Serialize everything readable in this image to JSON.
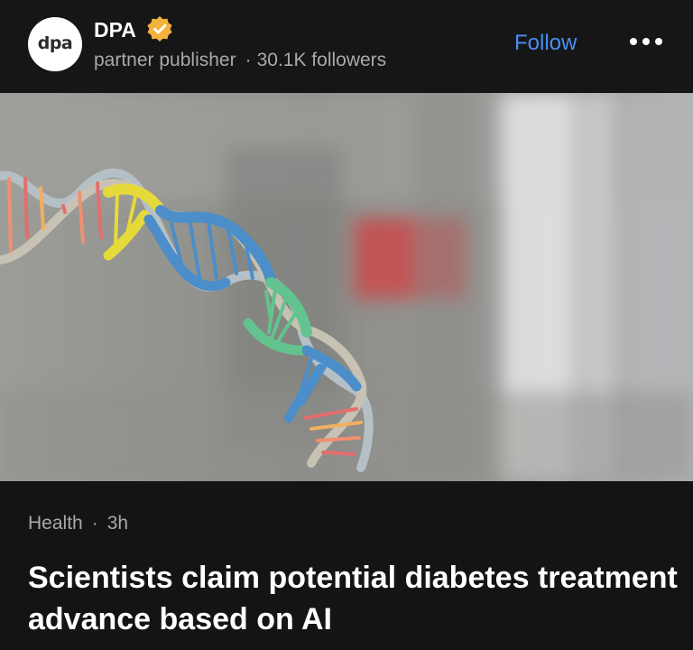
{
  "publisher": {
    "avatar_text": "dpa",
    "name": "DPA",
    "verified_badge_icon": "verified-badge-icon",
    "role": "partner publisher",
    "separator": "·",
    "followers": "30.1K followers",
    "follow_label": "Follow",
    "more_icon": "more-options-icon"
  },
  "article": {
    "image_subject": "dna-helix-model",
    "category": "Health",
    "separator": "·",
    "age": "3h",
    "headline": "Scientists claim potential diabetes treatment advance based on AI"
  },
  "colors": {
    "background": "#141414",
    "follow_link": "#4c8ef5",
    "badge": "#f2b33d",
    "secondary_text": "#a9a9a9"
  }
}
